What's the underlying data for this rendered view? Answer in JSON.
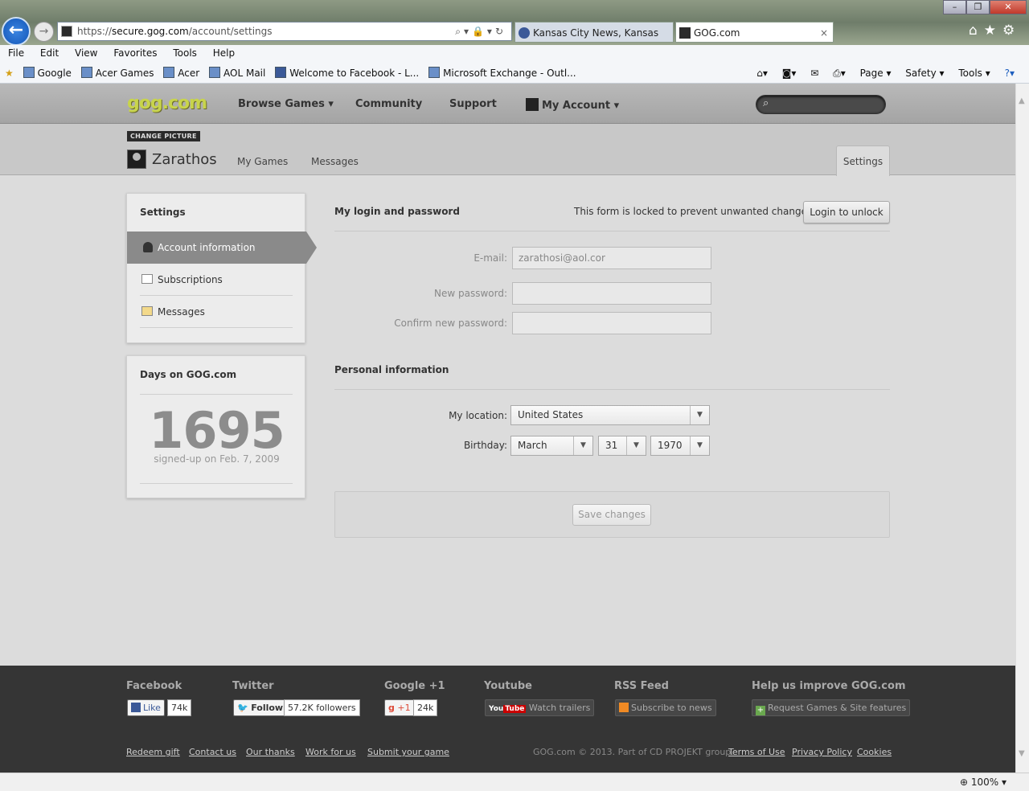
{
  "browser": {
    "url_scheme": "https://",
    "url_host": "secure.gog.com",
    "url_path": "/account/settings",
    "tabs": [
      {
        "label": "Kansas City News, Kansas City,..."
      },
      {
        "label": "GOG.com",
        "close": "×"
      }
    ],
    "menu": [
      "File",
      "Edit",
      "View",
      "Favorites",
      "Tools",
      "Help"
    ],
    "favorites": [
      "Google",
      "Acer Games",
      "Acer",
      "AOL Mail",
      "Welcome to Facebook - L...",
      "Microsoft Exchange - Outl..."
    ],
    "commands": {
      "page": "Page ▾",
      "safety": "Safety ▾",
      "tools": "Tools ▾"
    },
    "zoom": "100%"
  },
  "header": {
    "logo": "gog.com",
    "nav": {
      "browse": "Browse Games ▾",
      "community": "Community",
      "support": "Support",
      "account": "My Account ▾"
    }
  },
  "profile": {
    "change_picture": "CHANGE PICTURE",
    "username": "Zarathos",
    "links": {
      "games": "My Games",
      "messages": "Messages",
      "settings": "Settings"
    }
  },
  "sidebar": {
    "title": "Settings",
    "items": [
      {
        "label": "Account information"
      },
      {
        "label": "Subscriptions"
      },
      {
        "label": "Messages"
      }
    ]
  },
  "days": {
    "title": "Days on GOG.com",
    "count": "1695",
    "signed_up": "signed-up on Feb. 7, 2009"
  },
  "login": {
    "title": "My login and password",
    "lock_note": "This form is locked to prevent unwanted changes.",
    "unlock_button": "Login to unlock",
    "email_label": "E-mail:",
    "email_value": "zarathosi@aol.cor",
    "newpass_label": "New password:",
    "confirm_label": "Confirm new password:"
  },
  "personal": {
    "title": "Personal information",
    "location_label": "My location:",
    "location_value": "United States",
    "birthday_label": "Birthday:",
    "month": "March",
    "day": "31",
    "year": "1970"
  },
  "save_button": "Save changes",
  "footer": {
    "facebook": {
      "title": "Facebook",
      "button": "Like",
      "count": "74k"
    },
    "twitter": {
      "title": "Twitter",
      "button": "Follow",
      "count": "57.2K followers"
    },
    "google": {
      "title": "Google +1",
      "button": "+1",
      "count": "24k"
    },
    "youtube": {
      "title": "Youtube",
      "button": "Watch trailers"
    },
    "rss": {
      "title": "RSS Feed",
      "button": "Subscribe to news"
    },
    "help": {
      "title": "Help us improve GOG.com",
      "button": "Request Games & Site features"
    },
    "links": [
      "Redeem gift",
      "Contact us",
      "Our thanks",
      "Work for us",
      "Submit your game"
    ],
    "copyright": "GOG.com © 2013. Part of CD PROJEKT group.",
    "legal": [
      "Terms of Use",
      "Privacy Policy",
      "Cookies"
    ]
  }
}
